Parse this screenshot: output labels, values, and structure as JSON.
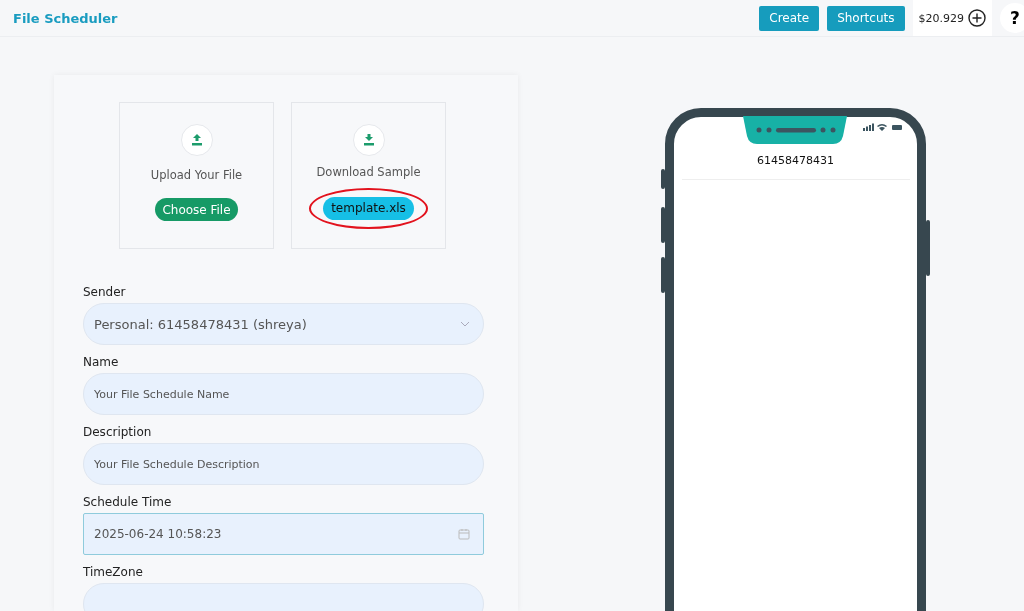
{
  "header": {
    "title": "File Scheduler",
    "buttons": [
      "Create",
      "Shortcuts"
    ],
    "balance": "$20.929",
    "help": "?"
  },
  "upload": {
    "label": "Upload Your File",
    "button": "Choose File"
  },
  "download": {
    "label": "Download Sample",
    "link": "template.xls",
    "highlighted": true
  },
  "fields": [
    {
      "kind": "select",
      "label": "Sender",
      "value": "Personal: 61458478431 (shreya)"
    },
    {
      "kind": "text",
      "label": "Name",
      "placeholder": "Your File Schedule Name"
    },
    {
      "kind": "text",
      "label": "Description",
      "placeholder": "Your File Schedule Description"
    },
    {
      "kind": "datetime",
      "label": "Schedule Time",
      "value": "2025-06-24 10:58:23"
    },
    {
      "kind": "select",
      "label": "TimeZone"
    }
  ],
  "phone": {
    "number": "61458478431"
  }
}
